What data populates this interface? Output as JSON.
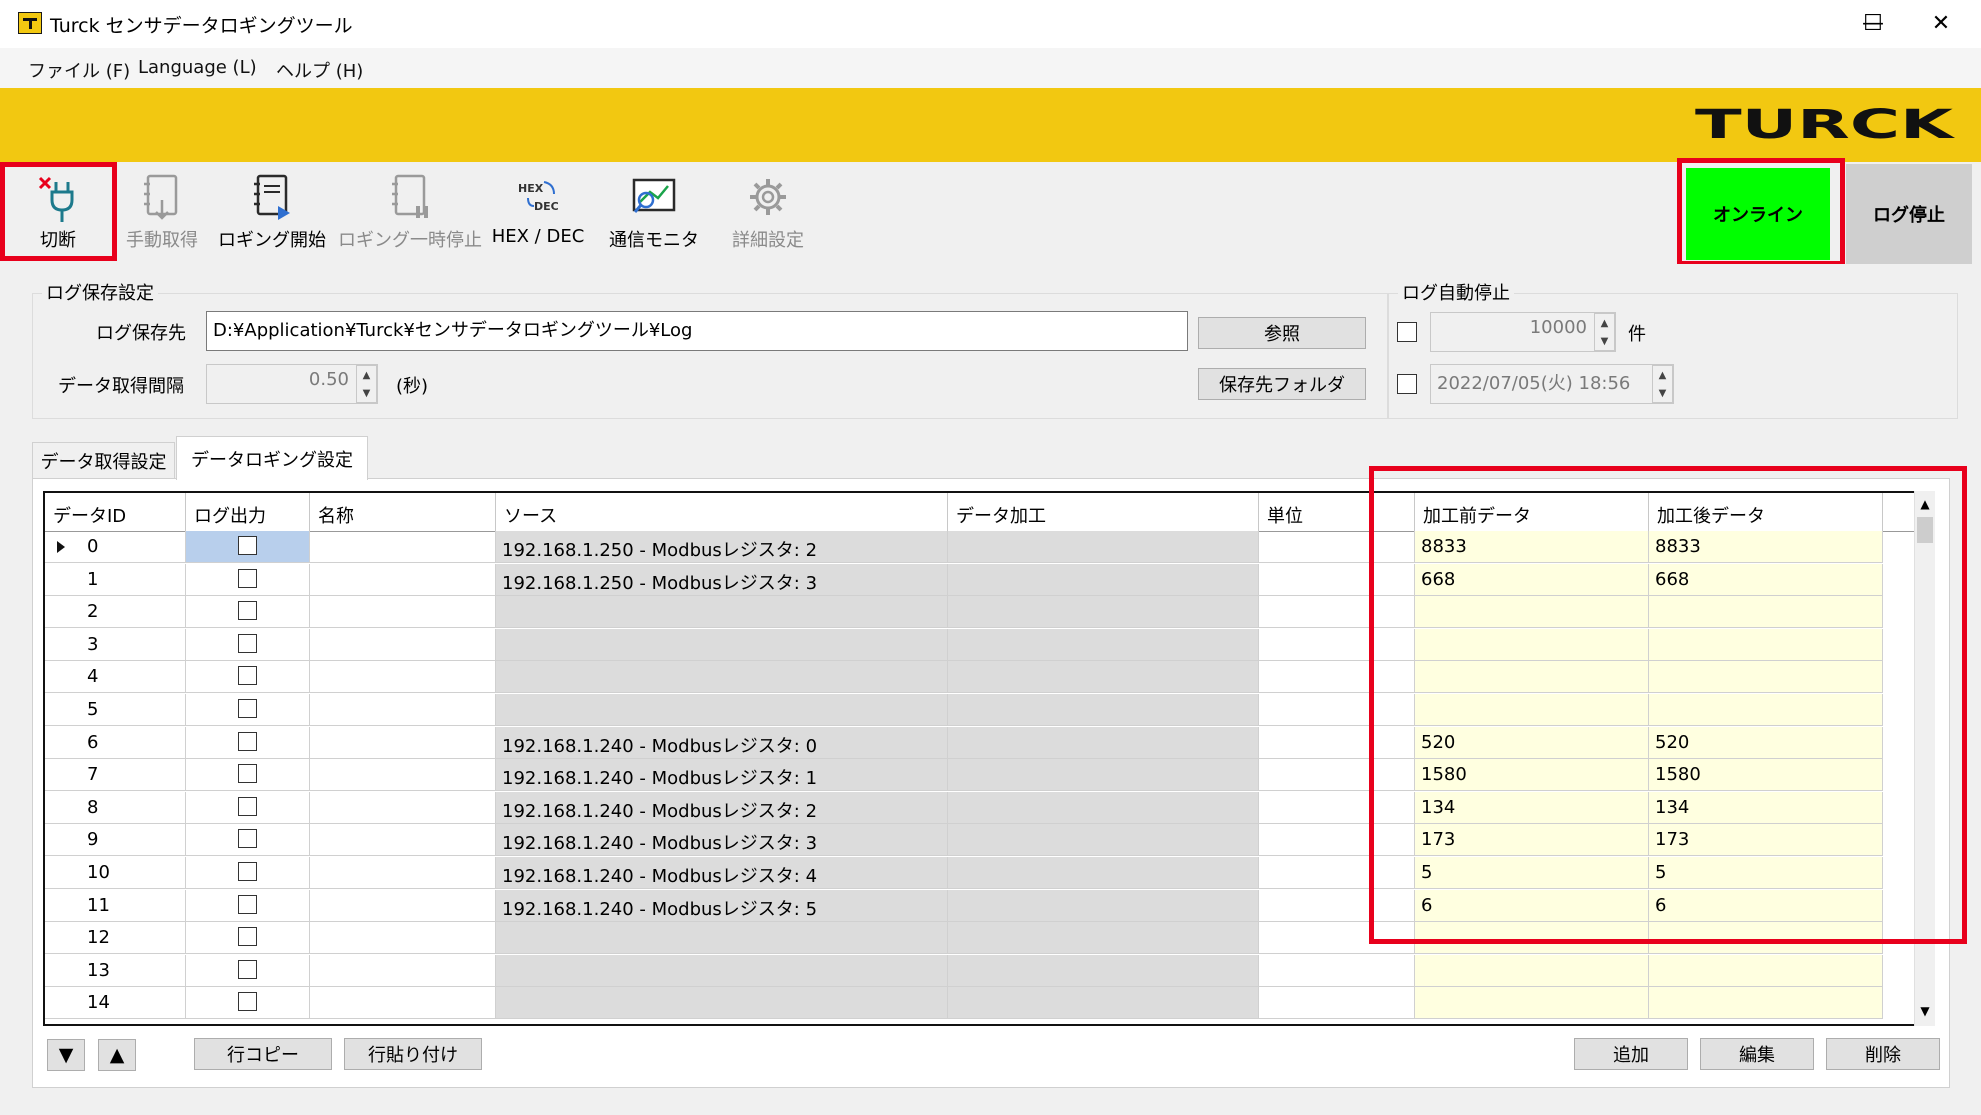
{
  "window": {
    "title": "Turck センサデータロギングツール",
    "minimize": "—",
    "maximize": "☐",
    "close": "✕"
  },
  "menu": [
    "ファイル (F)",
    "Language (L)",
    "ヘルプ (H)"
  ],
  "brand": {
    "logo_text": "TURCK",
    "banner_color": "#f2c811"
  },
  "toolbar": {
    "disconnect": "切断",
    "manual": "手動取得",
    "start_logging": "ロギング開始",
    "pause_logging": "ロギング一時停止",
    "hexdec": "HEX / DEC",
    "hexdec_icon_top": "HEX",
    "hexdec_icon_bottom": "DEC",
    "comm_monitor": "通信モニタ",
    "detail": "詳細設定",
    "online": "オンライン",
    "log_stop": "ログ停止",
    "online_color": "#00ff00",
    "highlight_color": "#e8001c"
  },
  "log_save": {
    "group_title": "ログ保存設定",
    "path_label": "ログ保存先",
    "path_value": "D:¥Application¥Turck¥センサデータロギングツール¥Log",
    "browse_button": "参照",
    "interval_label": "データ取得間隔",
    "interval_value": "0.50",
    "interval_unit": "(秒)",
    "folder_button": "保存先フォルダ"
  },
  "auto_stop": {
    "group_title": "ログ自動停止",
    "count_value": "10000",
    "count_unit": "件",
    "datetime_value": "2022/07/05(火) 18:56"
  },
  "tabs": {
    "acquisition": "データ取得設定",
    "logging": "データロギング設定"
  },
  "grid": {
    "columns": [
      "データID",
      "ログ出力",
      "名称",
      "ソース",
      "データ加工",
      "単位",
      "加工前データ",
      "加工後データ"
    ],
    "rows": [
      {
        "id": "0",
        "source": "192.168.1.250 - Modbusレジスタ: 2",
        "before": "8833",
        "after": "8833"
      },
      {
        "id": "1",
        "source": "192.168.1.250 - Modbusレジスタ: 3",
        "before": "668",
        "after": "668"
      },
      {
        "id": "2",
        "source": "",
        "before": "",
        "after": ""
      },
      {
        "id": "3",
        "source": "",
        "before": "",
        "after": ""
      },
      {
        "id": "4",
        "source": "",
        "before": "",
        "after": ""
      },
      {
        "id": "5",
        "source": "",
        "before": "",
        "after": ""
      },
      {
        "id": "6",
        "source": "192.168.1.240 - Modbusレジスタ: 0",
        "before": "520",
        "after": "520"
      },
      {
        "id": "7",
        "source": "192.168.1.240 - Modbusレジスタ: 1",
        "before": "1580",
        "after": "1580"
      },
      {
        "id": "8",
        "source": "192.168.1.240 - Modbusレジスタ: 2",
        "before": "134",
        "after": "134"
      },
      {
        "id": "9",
        "source": "192.168.1.240 - Modbusレジスタ: 3",
        "before": "173",
        "after": "173"
      },
      {
        "id": "10",
        "source": "192.168.1.240 - Modbusレジスタ: 4",
        "before": "5",
        "after": "5"
      },
      {
        "id": "11",
        "source": "192.168.1.240 - Modbusレジスタ: 5",
        "before": "6",
        "after": "6"
      },
      {
        "id": "12",
        "source": "",
        "before": "",
        "after": ""
      },
      {
        "id": "13",
        "source": "",
        "before": "",
        "after": ""
      },
      {
        "id": "14",
        "source": "",
        "before": "",
        "after": ""
      }
    ]
  },
  "bottom": {
    "row_copy": "行コピー",
    "row_paste": "行貼り付け",
    "add": "追加",
    "edit": "編集",
    "delete": "削除"
  }
}
